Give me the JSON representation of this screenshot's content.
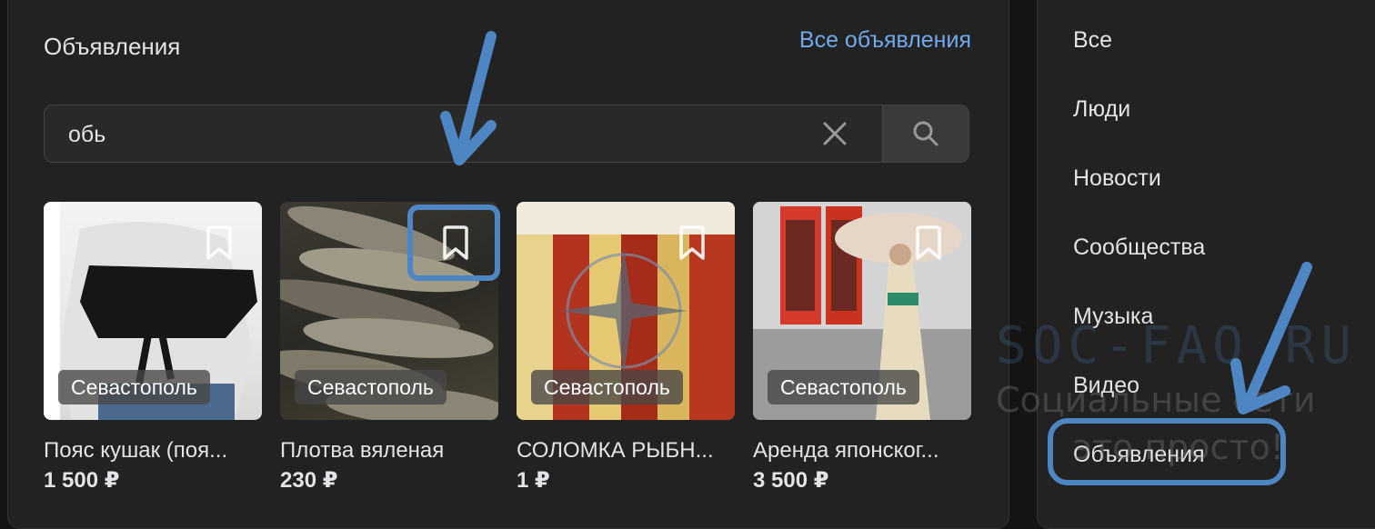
{
  "section": {
    "title": "Объявления",
    "all_link": "Все объявления"
  },
  "search": {
    "value": "обь"
  },
  "cards": [
    {
      "city": "Севастополь",
      "title": "Пояс кушак (поя...",
      "price": "1 500 ₽"
    },
    {
      "city": "Севастополь",
      "title": "Плотва вяленая",
      "price": "230 ₽"
    },
    {
      "city": "Севастополь",
      "title": "СОЛОМКА РЫБН...",
      "price": "1 ₽"
    },
    {
      "city": "Севастополь",
      "title": "Аренда японског...",
      "price": "3 500 ₽"
    }
  ],
  "sidebar": {
    "items": [
      {
        "label": "Все"
      },
      {
        "label": "Люди"
      },
      {
        "label": "Новости"
      },
      {
        "label": "Сообщества"
      },
      {
        "label": "Музыка"
      },
      {
        "label": "Видео"
      },
      {
        "label": "Объявления"
      }
    ]
  },
  "watermark": {
    "line1": "SOC-FAQ.RU",
    "line2": "Социальные сети",
    "line3": "это просто!"
  },
  "icons": {
    "clear": "close-icon",
    "search": "search-icon",
    "bookmark": "bookmark-icon"
  },
  "colors": {
    "accent": "#71aaeb",
    "annotation": "#4e86c4",
    "panel": "#222222",
    "background": "#141414"
  }
}
